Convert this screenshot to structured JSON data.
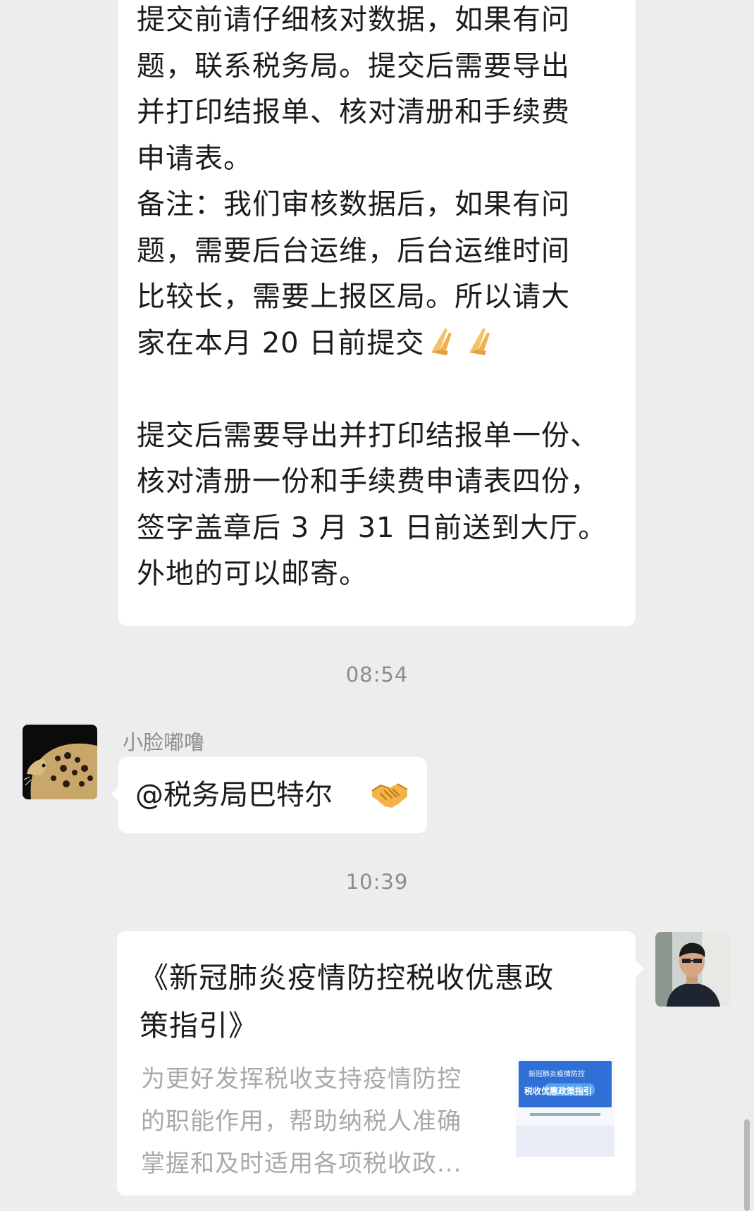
{
  "chat": {
    "message1": {
      "lines": [
        "提交前请仔细核对数据，如果有问",
        "题，联系税务局。提交后需要导出",
        "并打印结报单、核对清册和手续费",
        "申请表。",
        "备注：我们审核数据后，如果有问",
        "题，需要后台运维，后台运维时间",
        "比较长，需要上报区局。所以请大",
        "家在本月 20 日前提交",
        "",
        "提交后需要导出并打印结报单一份、",
        "核对清册一份和手续费申请表四份，",
        "签字盖章后 3 月 31 日前送到大厅。",
        "外地的可以邮寄。"
      ],
      "emoji": "folded-hands-icon"
    },
    "timestamp1": "08:54",
    "message2": {
      "sender": "小脸嘟噜",
      "text": "@税务局巴特尔",
      "emoji": "handshake-icon"
    },
    "timestamp2": "10:39",
    "message3": {
      "title": "《新冠肺炎疫情防控税收优惠政策指引》",
      "description": "为更好发挥税收支持疫情防控的职能作用，帮助纳税人准确掌握和及时适用各项税收政...",
      "thumbnail_line1": "新冠肺炎疫情防控",
      "thumbnail_line2": "税收优惠政策指引"
    }
  }
}
